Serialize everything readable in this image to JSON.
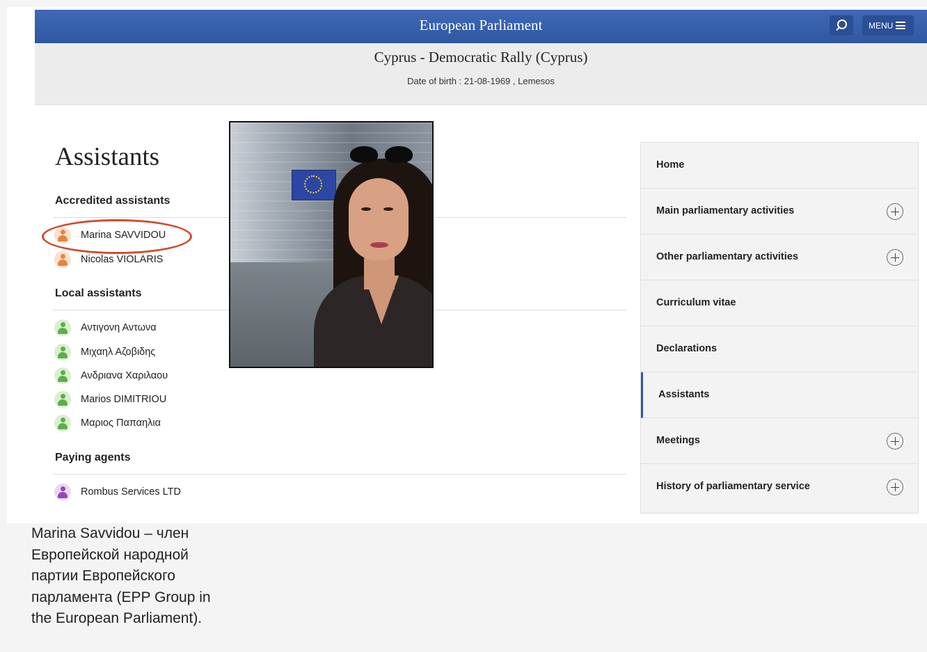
{
  "header": {
    "brand": "European Parliament",
    "menu_label": "MENU",
    "search_icon": "search-icon",
    "menu_icon": "hamburger-icon"
  },
  "member": {
    "party": "Cyprus - Democratic Rally (Cyprus)",
    "dob": "Date of birth : 21-08-1969 , Lemesos"
  },
  "main": {
    "title": "Assistants",
    "sections": [
      {
        "title": "Accredited assistants",
        "color": "#e5843e",
        "people": [
          "Marina SAVVIDOU",
          "Nicolas VIOLARIS"
        ]
      },
      {
        "title": "Local assistants",
        "color": "#5fae48",
        "people": [
          "Αντιγονη Αντωνα",
          "Μιχαηλ Αζοβιδης",
          "Ανδριανα Χαριλαου",
          "Marios DIMITRIOU",
          "Μαριος Παπαηλια"
        ]
      },
      {
        "title": "Paying agents",
        "color": "#9b44bd",
        "people": [
          "Rombus Services LTD"
        ]
      }
    ],
    "highlight_color": "#d24a2b"
  },
  "sidebar": {
    "accent": "#2f58a4",
    "items": [
      {
        "label": "Home",
        "expandable": false
      },
      {
        "label": "Main parliamentary activities",
        "expandable": true
      },
      {
        "label": "Other parliamentary activities",
        "expandable": true
      },
      {
        "label": "Curriculum vitae",
        "expandable": false
      },
      {
        "label": "Declarations",
        "expandable": false
      },
      {
        "label": "Assistants",
        "expandable": false,
        "active": true
      },
      {
        "label": "Meetings",
        "expandable": true
      },
      {
        "label": "History of parliamentary service",
        "expandable": true
      }
    ]
  },
  "caption": "Marina Savvidou – член Европейской народной партии Европейского парламента (EPP Group in the European Parliament)."
}
